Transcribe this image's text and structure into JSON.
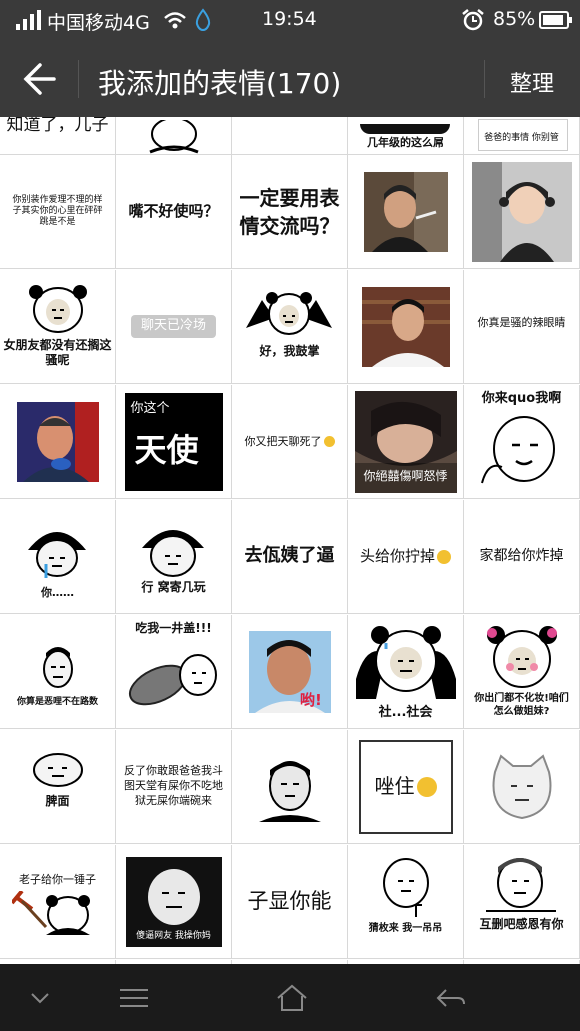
{
  "status": {
    "carrier": "中国移动4G",
    "time": "19:54",
    "battery": "85%"
  },
  "appbar": {
    "title": "我添加的表情(170)",
    "manage": "整理"
  },
  "cells": {
    "r0c0": "知道了，儿子",
    "r0c3": "几年级的这么屌",
    "r0c4": "爸爸的事情 你别管",
    "r1c0": "你别装作爱理不理的样子其实你的心里在砰砰跳是不是",
    "r1c1": "嘴不好使吗？",
    "r1c2": "一定要用表情交流吗？",
    "r2c0": "女朋友都没有还搁这骚呢",
    "r2c1": "聊天已冷场",
    "r2c2": "好，我鼓掌",
    "r2c4": "你真是骚的辣眼睛",
    "r3c1a": "你这个",
    "r3c1b": "天使",
    "r3c2": "你又把天聊死了",
    "r3c3": "你絕囍傷啊怒悸",
    "r3c4": "你来quo我啊",
    "r4c0": "你……",
    "r4c1": "行 窝寄几玩",
    "r4c2": "去佤姨了逼",
    "r4c3": "头给你拧掉",
    "r4c4": "家都给你炸掉",
    "r5c0": "你算是恶哩不在路数",
    "r5c1": "吃我一井盖!!!",
    "r5c2": "哟!",
    "r5c3": "社...社会",
    "r5c4": "你出门都不化妆!咱们怎么做姐妹?",
    "r6c0": "脾面",
    "r6c1": "反了你敢跟爸爸我斗图天堂有屎你不吃地狱无屎你端碗来",
    "r6c3": "唑住",
    "r7c0": "老子给你一锤子",
    "r7c1": "傻逼网友 我操你妈",
    "r7c2": "子显你能",
    "r7c3": "猜枚来 我一吊吊",
    "r7c4": "互删吧感恩有你"
  }
}
